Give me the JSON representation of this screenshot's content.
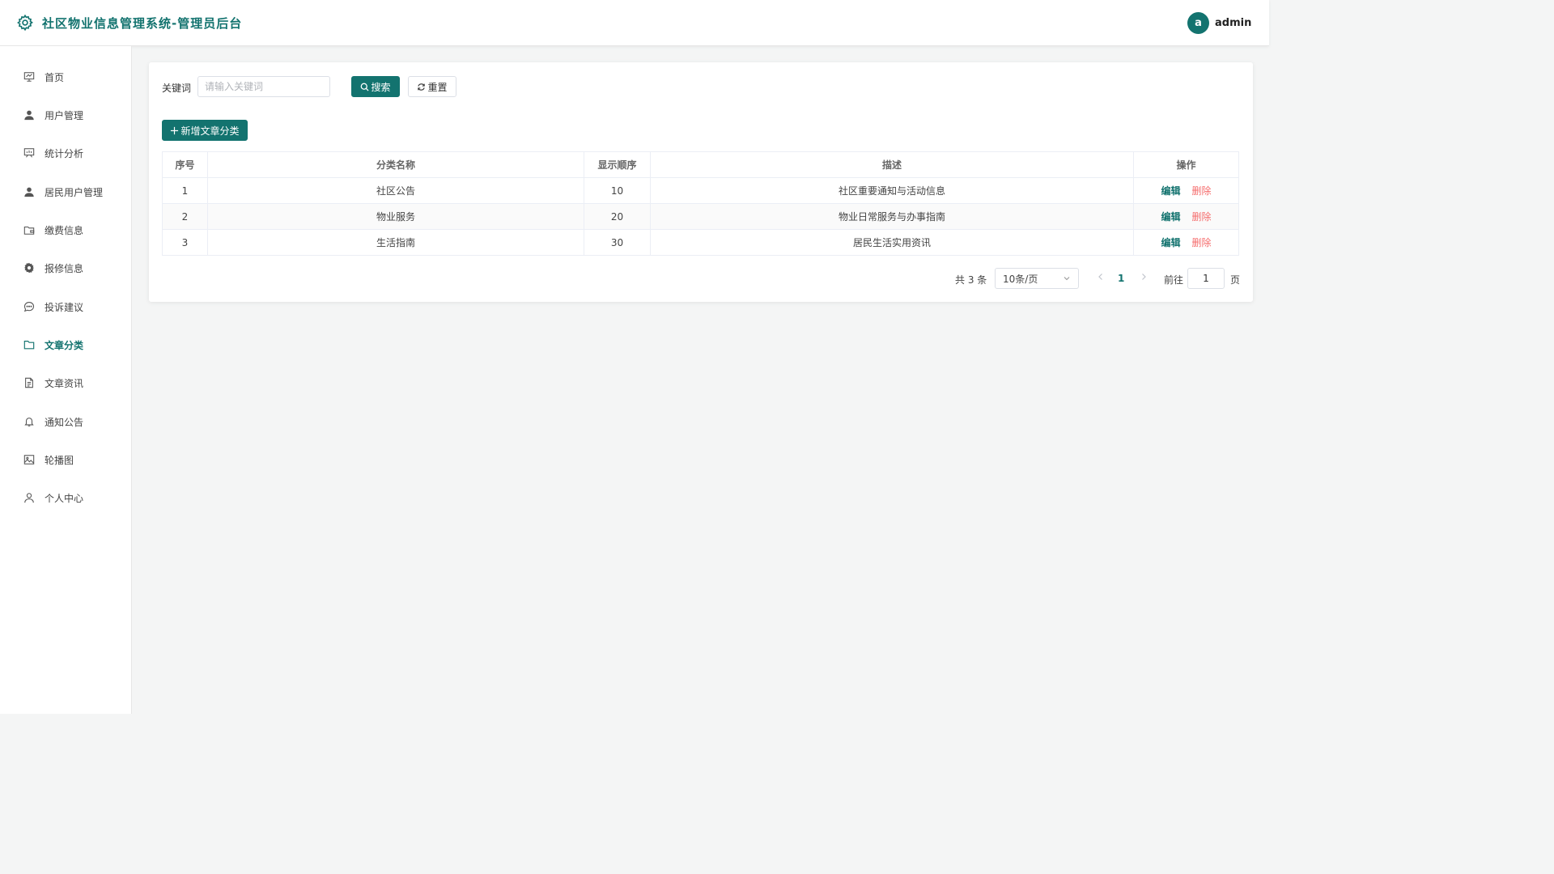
{
  "header": {
    "title": "社区物业信息管理系统-管理员后台",
    "avatar_letter": "a",
    "username": "admin",
    "brand_icon": "gear-icon",
    "accent_color": "#13736f"
  },
  "sidebar": {
    "items": [
      {
        "label": "首页",
        "icon": "presentation-icon"
      },
      {
        "label": "用户管理",
        "icon": "user-filled-icon"
      },
      {
        "label": "统计分析",
        "icon": "chart-board-icon"
      },
      {
        "label": "居民用户管理",
        "icon": "user-filled-icon"
      },
      {
        "label": "缴费信息",
        "icon": "wallet-folder-icon"
      },
      {
        "label": "报修信息",
        "icon": "settings-icon"
      },
      {
        "label": "投诉建议",
        "icon": "chat-dots-icon"
      },
      {
        "label": "文章分类",
        "icon": "folder-icon",
        "active": true
      },
      {
        "label": "文章资讯",
        "icon": "document-icon"
      },
      {
        "label": "通知公告",
        "icon": "bell-icon"
      },
      {
        "label": "轮播图",
        "icon": "picture-icon"
      },
      {
        "label": "个人中心",
        "icon": "user-outline-icon"
      }
    ]
  },
  "search": {
    "label": "关键词",
    "placeholder": "请输入关键词",
    "value": "",
    "search_button": "搜索",
    "reset_button": "重置"
  },
  "add_button": "新增文章分类",
  "table": {
    "headers": [
      "序号",
      "分类名称",
      "显示顺序",
      "描述",
      "操作"
    ],
    "rows": [
      {
        "index": "1",
        "name": "社区公告",
        "order": "10",
        "desc": "社区重要通知与活动信息"
      },
      {
        "index": "2",
        "name": "物业服务",
        "order": "20",
        "desc": "物业日常服务与办事指南"
      },
      {
        "index": "3",
        "name": "生活指南",
        "order": "30",
        "desc": "居民生活实用资讯"
      }
    ],
    "edit_label": "编辑",
    "delete_label": "删除"
  },
  "pagination": {
    "total": "共 3 条",
    "page_size": "10条/页",
    "current_page": "1",
    "goto_label": "前往",
    "goto_value": "1",
    "page_unit": "页"
  }
}
